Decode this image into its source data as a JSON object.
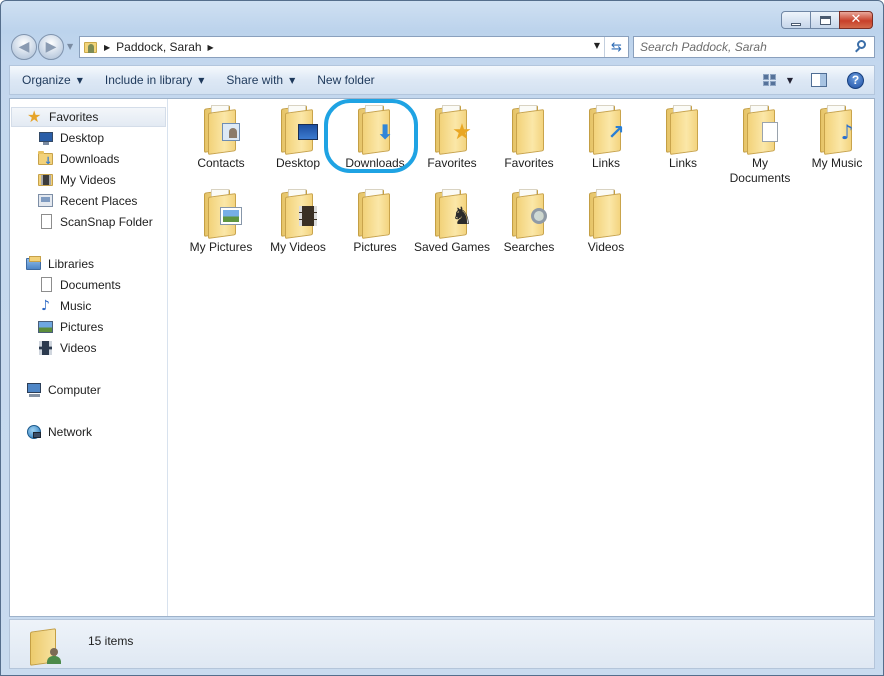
{
  "window": {
    "caption_close_glyph": "✕"
  },
  "nav": {
    "back_glyph": "◀",
    "forward_glyph": "▶",
    "address_path": "Paddock, Sarah",
    "search_placeholder": "Search Paddock, Sarah",
    "refresh_glyph": "⇆"
  },
  "command_bar": {
    "organize": "Organize",
    "include_in_library": "Include in library",
    "share_with": "Share with",
    "new_folder": "New folder",
    "help": "?"
  },
  "sidebar": {
    "favorites_header": "Favorites",
    "favorites": [
      {
        "label": "Desktop",
        "icon": "desktop-icon"
      },
      {
        "label": "Downloads",
        "icon": "downloads-folder-icon"
      },
      {
        "label": "My Videos",
        "icon": "videos-icon"
      },
      {
        "label": "Recent Places",
        "icon": "recent-places-icon"
      },
      {
        "label": "ScanSnap Folder",
        "icon": "document-icon"
      }
    ],
    "libraries_header": "Libraries",
    "libraries": [
      {
        "label": "Documents",
        "icon": "document-icon"
      },
      {
        "label": "Music",
        "icon": "music-icon"
      },
      {
        "label": "Pictures",
        "icon": "pictures-icon"
      },
      {
        "label": "Videos",
        "icon": "videos-icon"
      }
    ],
    "computer": "Computer",
    "network": "Network"
  },
  "folders": [
    {
      "label": "Contacts",
      "icon": "contacts-folder-icon"
    },
    {
      "label": "Desktop",
      "icon": "desktop-folder-icon"
    },
    {
      "label": "Downloads",
      "icon": "downloads-folder-icon"
    },
    {
      "label": "Favorites",
      "icon": "favorites-folder-icon"
    },
    {
      "label": "Favorites",
      "icon": "folder-icon"
    },
    {
      "label": "Links",
      "icon": "links-folder-icon"
    },
    {
      "label": "Links",
      "icon": "folder-icon"
    },
    {
      "label": "My Documents",
      "icon": "documents-folder-icon"
    },
    {
      "label": "My Music",
      "icon": "music-folder-icon"
    },
    {
      "label": "My Pictures",
      "icon": "pictures-folder-icon"
    },
    {
      "label": "My Videos",
      "icon": "videos-folder-icon"
    },
    {
      "label": "Pictures",
      "icon": "folder-icon"
    },
    {
      "label": "Saved Games",
      "icon": "saved-games-folder-icon"
    },
    {
      "label": "Searches",
      "icon": "searches-folder-icon"
    },
    {
      "label": "Videos",
      "icon": "folder-icon"
    }
  ],
  "status": {
    "item_count": "15 items"
  },
  "colors": {
    "highlight_ring": "#1fa3e3",
    "link_text": "#1e395b"
  }
}
